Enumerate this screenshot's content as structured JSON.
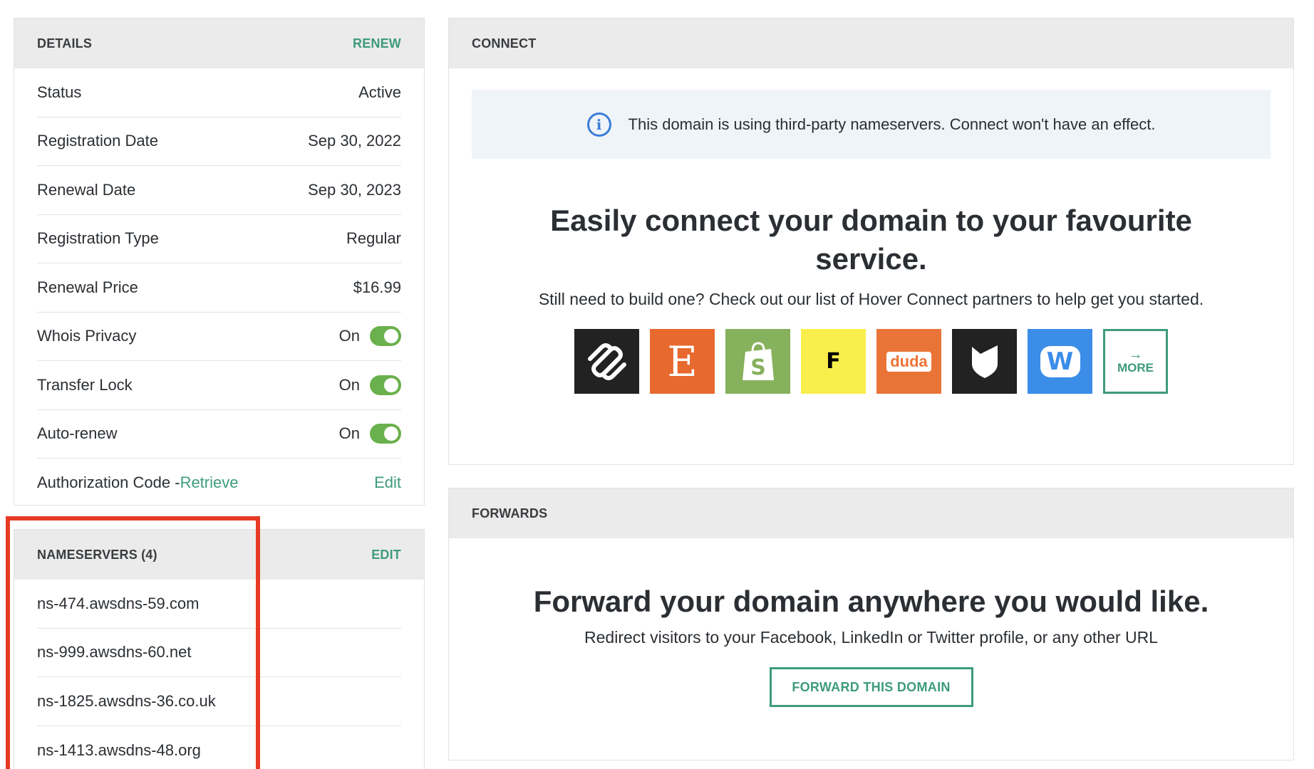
{
  "details": {
    "title": "DETAILS",
    "renew_label": "RENEW",
    "rows": [
      {
        "label": "Status",
        "value": "Active"
      },
      {
        "label": "Registration Date",
        "value": "Sep 30, 2022"
      },
      {
        "label": "Renewal Date",
        "value": "Sep 30, 2023"
      },
      {
        "label": "Registration Type",
        "value": "Regular"
      },
      {
        "label": "Renewal Price",
        "value": "$16.99"
      },
      {
        "label": "Whois Privacy",
        "value": "On"
      },
      {
        "label": "Transfer Lock",
        "value": "On"
      },
      {
        "label": "Auto-renew",
        "value": "On"
      }
    ],
    "auth_code": {
      "label": "Authorization Code -",
      "retrieve": "Retrieve",
      "edit": "Edit"
    }
  },
  "nameservers": {
    "title": "NAMESERVERS (4)",
    "edit_label": "EDIT",
    "items": [
      "ns-474.awsdns-59.com",
      "ns-999.awsdns-60.net",
      "ns-1825.awsdns-36.co.uk",
      "ns-1413.awsdns-48.org"
    ]
  },
  "connect": {
    "title": "CONNECT",
    "notice": "This domain is using third-party nameservers. Connect won't have an effect.",
    "headline_line1": "Easily connect your domain to your favourite",
    "headline_line2": "service.",
    "subtext": "Still need to build one? Check out our list of Hover Connect partners to help get you started.",
    "partners": [
      {
        "icon": "squarespace-icon",
        "color": "#222222"
      },
      {
        "icon": "etsy-icon",
        "text": "E",
        "color": "#e8692e"
      },
      {
        "icon": "shopify-icon",
        "text": "S",
        "color": "#86b15d"
      },
      {
        "icon": "format-icon",
        "text": "F",
        "color": "#f8ee4c"
      },
      {
        "icon": "duda-icon",
        "text": "duda",
        "color": "#ea7437"
      },
      {
        "icon": "bigcartel-icon",
        "color": "#222222"
      },
      {
        "icon": "weebly-icon",
        "text": "W",
        "color": "#3b8de8"
      }
    ],
    "more_arrow": "→",
    "more_label": "MORE"
  },
  "forwards": {
    "title": "FORWARDS",
    "headline": "Forward your domain anywhere you would like.",
    "subtext": "Redirect visitors to your Facebook, LinkedIn or Twitter profile, or any other URL",
    "button_label": "FORWARD THIS DOMAIN"
  },
  "colors": {
    "accent": "#3e9b7e",
    "toggle": "#6ab04c",
    "highlight": "#e63a24",
    "info": "#3b7dd8"
  }
}
